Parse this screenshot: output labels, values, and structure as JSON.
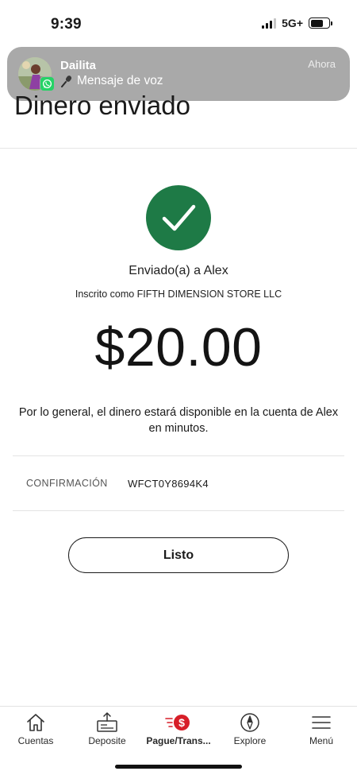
{
  "status_bar": {
    "time": "9:39",
    "network": "5G+",
    "signal_bars_active": 3,
    "signal_bars_total": 4,
    "battery_level": 0.7
  },
  "notification": {
    "app_icon": "whatsapp-icon",
    "sender": "Dailita",
    "message_icon": "microphone-icon",
    "message": "Mensaje de voz",
    "time": "Ahora"
  },
  "page": {
    "title": "Dinero enviado"
  },
  "confirmation": {
    "status_icon": "checkmark-icon",
    "status_color": "#1e7a46",
    "sent_to": "Enviado(a) a Alex",
    "enrolled_as": "Inscrito como FIFTH DIMENSION STORE LLC",
    "amount": "$20.00",
    "availability_note": "Por lo general, el dinero estará disponible en la cuenta de Alex en minutos.",
    "confirmation_label": "CONFIRMACIÓN",
    "confirmation_number": "WFCT0Y8694K4"
  },
  "actions": {
    "done_label": "Listo"
  },
  "tabbar": {
    "accent_color": "#d71e28",
    "items": [
      {
        "label": "Cuentas",
        "icon": "home-icon",
        "active": false
      },
      {
        "label": "Deposite",
        "icon": "deposit-check-icon",
        "active": false
      },
      {
        "label": "Pague/Trans...",
        "icon": "dollar-transfer-icon",
        "active": true
      },
      {
        "label": "Explore",
        "icon": "compass-icon",
        "active": false
      },
      {
        "label": "Menú",
        "icon": "hamburger-menu-icon",
        "active": false
      }
    ]
  }
}
